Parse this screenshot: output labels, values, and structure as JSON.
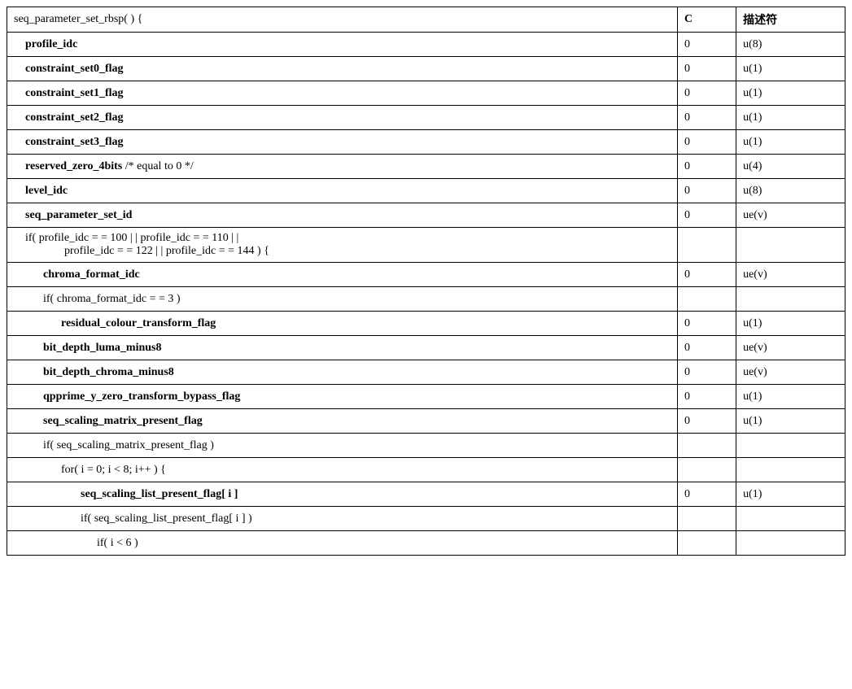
{
  "header": {
    "syntax": "seq_parameter_set_rbsp( ) {",
    "c_label": "C",
    "desc_label": "描述符"
  },
  "rows": [
    {
      "text": "profile_idc",
      "bold": true,
      "indent": 1,
      "c": "0",
      "desc": "u(8)"
    },
    {
      "text": "constraint_set0_flag",
      "bold": true,
      "indent": 1,
      "c": "0",
      "desc": "u(1)"
    },
    {
      "text": "constraint_set1_flag",
      "bold": true,
      "indent": 1,
      "c": "0",
      "desc": "u(1)"
    },
    {
      "text": "constraint_set2_flag",
      "bold": true,
      "indent": 1,
      "c": "0",
      "desc": "u(1)"
    },
    {
      "text": "constraint_set3_flag",
      "bold": true,
      "indent": 1,
      "c": "0",
      "desc": "u(1)"
    },
    {
      "text": "reserved_zero_4bits",
      "bold": true,
      "comment": " /* equal to 0 */",
      "indent": 1,
      "c": "0",
      "desc": "u(4)"
    },
    {
      "text": "level_idc",
      "bold": true,
      "indent": 1,
      "c": "0",
      "desc": "u(8)"
    },
    {
      "text": "seq_parameter_set_id",
      "bold": true,
      "indent": 1,
      "c": "0",
      "desc": "ue(v)"
    },
    {
      "text": "if(    profile_idc     =  =     100     |  |     profile_idc     =  =     110     |  |",
      "text2": "profile_idc  = =  122  | |  profile_idc  = =  144 ) {",
      "twoLine": true,
      "bold": false,
      "indent": 1,
      "c": "",
      "desc": ""
    },
    {
      "text": "chroma_format_idc",
      "bold": true,
      "indent": 2,
      "c": "0",
      "desc": "ue(v)"
    },
    {
      "text": "if( chroma_format_idc  = =  3 )",
      "bold": false,
      "indent": 2,
      "c": "",
      "desc": ""
    },
    {
      "text": "residual_colour_transform_flag",
      "bold": true,
      "indent": 3,
      "c": "0",
      "desc": "u(1)"
    },
    {
      "text": "bit_depth_luma_minus8",
      "bold": true,
      "indent": 2,
      "c": "0",
      "desc": "ue(v)"
    },
    {
      "text": "bit_depth_chroma_minus8",
      "bold": true,
      "indent": 2,
      "c": "0",
      "desc": "ue(v)"
    },
    {
      "text": "qpprime_y_zero_transform_bypass_flag",
      "bold": true,
      "indent": 2,
      "c": "0",
      "desc": "u(1)"
    },
    {
      "text": "seq_scaling_matrix_present_flag",
      "bold": true,
      "indent": 2,
      "c": "0",
      "desc": "u(1)"
    },
    {
      "text": "if( seq_scaling_matrix_present_flag )",
      "bold": false,
      "indent": 2,
      "c": "",
      "desc": ""
    },
    {
      "text": "for( i = 0; i < 8; i++ ) {",
      "bold": false,
      "indent": 3,
      "c": "",
      "desc": ""
    },
    {
      "text": "seq_scaling_list_present_flag[ i ]",
      "bold": true,
      "indent": 4,
      "c": "0",
      "desc": "u(1)"
    },
    {
      "text": "if( seq_scaling_list_present_flag[ i ] )",
      "bold": false,
      "indent": 4,
      "c": "",
      "desc": ""
    },
    {
      "text": "if( i < 6 )",
      "bold": false,
      "indent": 5,
      "c": "",
      "desc": ""
    }
  ]
}
